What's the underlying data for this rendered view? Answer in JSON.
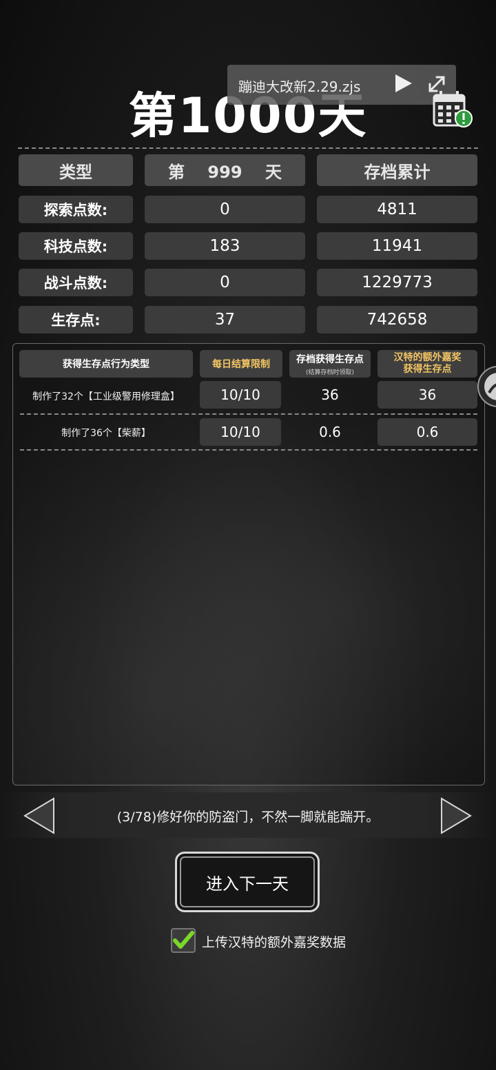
{
  "header": {
    "day_title": "第1000天",
    "overlay_label": "蹦迪大改新2.29.zjs"
  },
  "stats_table": {
    "headers": [
      "类型",
      "第    999    天",
      "存档累计"
    ],
    "rows": [
      {
        "label": "探索点数:",
        "today": "0",
        "total": "4811"
      },
      {
        "label": "科技点数:",
        "today": "183",
        "total": "11941"
      },
      {
        "label": "战斗点数:",
        "today": "0",
        "total": "1229773"
      },
      {
        "label": "生存点:",
        "today": "37",
        "total": "742658"
      }
    ]
  },
  "survival_table": {
    "headers": {
      "type": "获得生存点行为类型",
      "daily_limit": "每日结算限制",
      "save_points": "存档获得生存点",
      "save_points_sub": "(结算存档时领取)",
      "bonus_line1": "汉特的额外嘉奖",
      "bonus_line2": "获得生存点"
    },
    "rows": [
      {
        "action": "制作了32个【工业级警用修理盒】",
        "limit": "10/10",
        "save": "36",
        "bonus": "36"
      },
      {
        "action": "制作了36个【柴薪】",
        "limit": "10/10",
        "save": "0.6",
        "bonus": "0.6"
      }
    ]
  },
  "tip": {
    "text": "(3/78)修好你的防盗门，不然一脚就能踹开。"
  },
  "actions": {
    "next_day_label": "进入下一天",
    "upload_label": "上传汉特的额外嘉奖数据",
    "upload_checked": true
  },
  "colors": {
    "gold_header": "#f3c463",
    "check_green": "#7bd82a",
    "cell_bg": "#3c3c3c"
  }
}
